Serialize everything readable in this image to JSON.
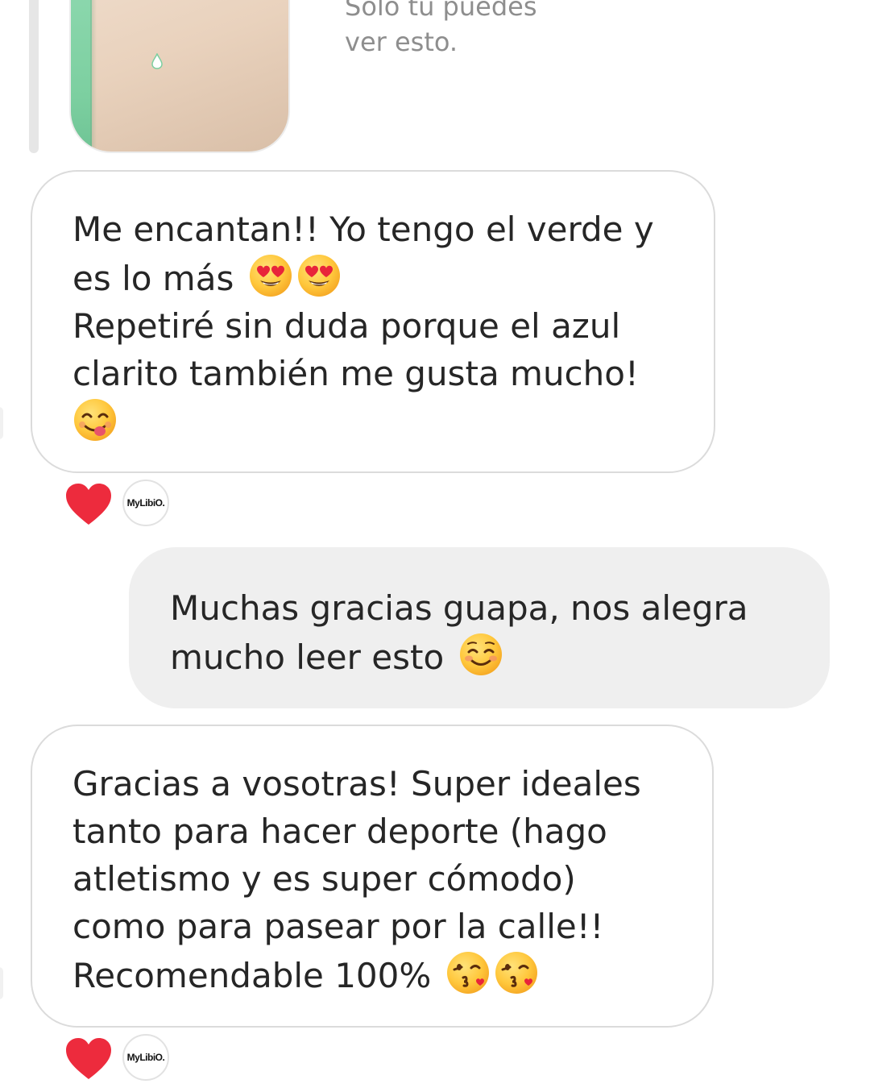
{
  "story_reply": {
    "note": "Solo tú puedes\nver esto."
  },
  "messages": [
    {
      "direction": "incoming",
      "lines": [
        "Me encantan!! Yo tengo el verde y",
        "es lo más",
        "Repetiré sin duda porque el azul",
        "clarito también me gusta mucho!",
        ""
      ],
      "reaction": "heart",
      "reactor_label": "MyLibiO."
    },
    {
      "direction": "outgoing",
      "lines": [
        "Muchas gracias guapa, nos alegra",
        "mucho leer esto"
      ]
    },
    {
      "direction": "incoming",
      "lines": [
        "Gracias a vosotras! Super ideales",
        "tanto para hacer deporte (hago",
        "atletismo y es super cómodo)",
        "como para pasear por la calle!!",
        "Recomendable 100%"
      ],
      "reaction": "heart",
      "reactor_label": "MyLibiO."
    }
  ],
  "icons": {
    "heart_eyes": "smiling-face-with-heart-eyes-emoji",
    "yum": "face-savoring-food-emoji",
    "blush": "smiling-face-with-smiling-eyes-emoji",
    "kiss": "face-blowing-a-kiss-emoji",
    "reaction": "red-heart-icon"
  },
  "colors": {
    "heart": "#ed2b3d",
    "incoming_border": "#dbdbdb",
    "outgoing_bg": "#efefef",
    "muted_text": "#8e8e8e"
  }
}
